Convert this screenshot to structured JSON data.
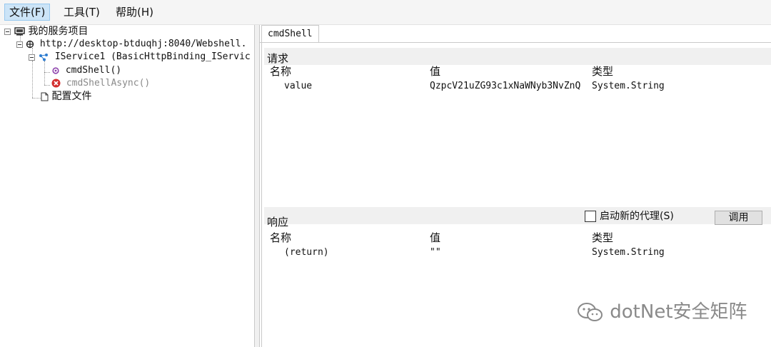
{
  "menu": {
    "file": "文件(F)",
    "tools": "工具(T)",
    "help": "帮助(H)"
  },
  "tree": {
    "root": "我的服务项目",
    "endpoint": "http://desktop-btduqhj:8040/Webshell.",
    "service": "IService1 (BasicHttpBinding_IServic",
    "method_sync": "cmdShell()",
    "method_async": "cmdShellAsync()",
    "config": "配置文件"
  },
  "tab": {
    "label": "cmdShell"
  },
  "request": {
    "title": "请求",
    "columns": [
      "名称",
      "值",
      "类型"
    ],
    "rows": [
      {
        "name": "value",
        "value": "QzpcV21uZG93c1xNaWNyb3NvZnQ",
        "type": "System.String"
      }
    ]
  },
  "response": {
    "title": "响应",
    "new_proxy_label": "启动新的代理(S)",
    "invoke_label": "调用",
    "columns": [
      "名称",
      "值",
      "类型"
    ],
    "rows": [
      {
        "name": "(return)",
        "value": "\"\"",
        "type": "System.String"
      }
    ]
  },
  "watermark": {
    "text": "dotNet安全矩阵"
  },
  "colors": {
    "menu_active_bg": "#cce4f7",
    "section_bg": "#f0f0f0",
    "error_red": "#d32f2f",
    "method_purple": "#8e44ad"
  }
}
